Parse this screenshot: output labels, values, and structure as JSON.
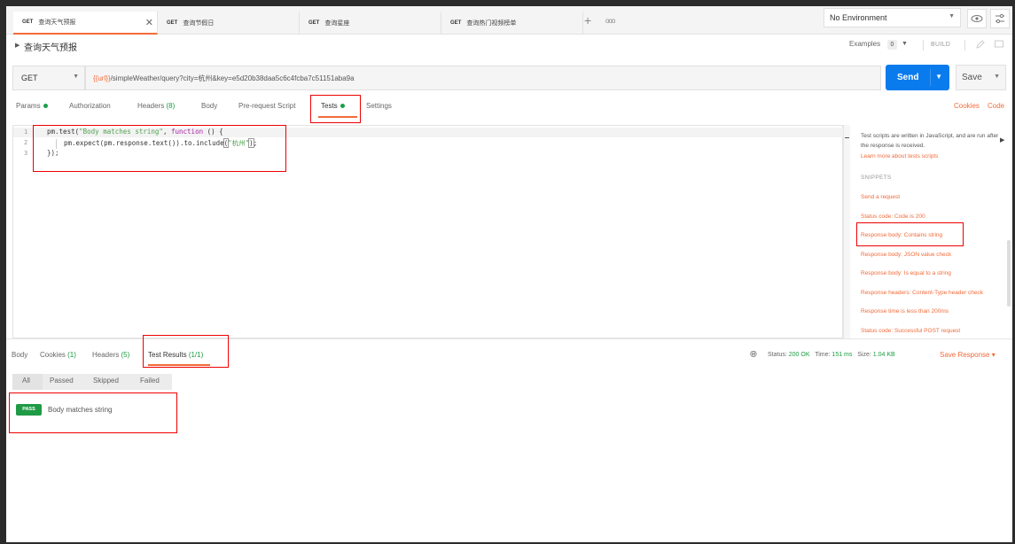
{
  "tabs": [
    {
      "method": "GET",
      "name": "查询天气预报",
      "active": true
    },
    {
      "method": "GET",
      "name": "查询节假日",
      "active": false
    },
    {
      "method": "GET",
      "name": "查询星座",
      "active": false
    },
    {
      "method": "GET",
      "name": "查询热门视频榜单",
      "active": false
    }
  ],
  "tabbar": {
    "add": "+",
    "more": "ooo"
  },
  "environment": {
    "selected": "No Environment"
  },
  "request": {
    "title": "查询天气预报",
    "examples_label": "Examples",
    "examples_count": "0",
    "build_label": "BUILD",
    "method": "GET",
    "url_var": "{{url}}",
    "url_rest": "/simpleWeather/query?city=杭州&key=e5d20b38daa5c6c4fcba7c51151aba9a",
    "send_label": "Send",
    "save_label": "Save"
  },
  "request_tabs": {
    "params": "Params",
    "authorization": "Authorization",
    "headers": "Headers",
    "headers_count": "(8)",
    "body": "Body",
    "prerequest": "Pre-request Script",
    "tests": "Tests",
    "settings": "Settings",
    "cookies": "Cookies",
    "code": "Code"
  },
  "editor": {
    "line_numbers": [
      "1",
      "2",
      "3"
    ],
    "line1_fn": "pm.test(",
    "line1_str": "\"Body matches string\"",
    "line1_sep": ", ",
    "line1_kw": "function",
    "line1_end": " () {",
    "line2_pre": "pm.expect(pm.response.text()).to.include",
    "line2_open": "(",
    "line2_str": "\"杭州\"",
    "line2_close": ")",
    "line2_end": ";",
    "line3": "});"
  },
  "snippets": {
    "intro": "Test scripts are written in JavaScript, and are run after the response is received.",
    "learn_more": "Learn more about tests scripts",
    "heading": "SNIPPETS",
    "items": [
      "Send a request",
      "Status code: Code is 200",
      "Response body: Contains string",
      "Response body: JSON value check",
      "Response body: Is equal to a string",
      "Response headers: Content-Type header check",
      "Response time is less than 200ms",
      "Status code: Successful POST request"
    ]
  },
  "response": {
    "tabs": {
      "body": "Body",
      "cookies": "Cookies",
      "cookies_count": "(1)",
      "headers": "Headers",
      "headers_count": "(5)",
      "test_results": "Test Results",
      "test_results_count": "(1/1)"
    },
    "status_label": "Status:",
    "status_value": "200 OK",
    "time_label": "Time:",
    "time_value": "151 ms",
    "size_label": "Size:",
    "size_value": "1.04 KB",
    "save_response": "Save Response"
  },
  "filters": [
    "All",
    "Passed",
    "Skipped",
    "Failed"
  ],
  "results": [
    {
      "badge": "PASS",
      "name": "Body matches string"
    }
  ],
  "colors": {
    "accent": "#f26b3a",
    "send": "#097bed",
    "pass": "#1f9a45",
    "annotation": "#e00000"
  }
}
